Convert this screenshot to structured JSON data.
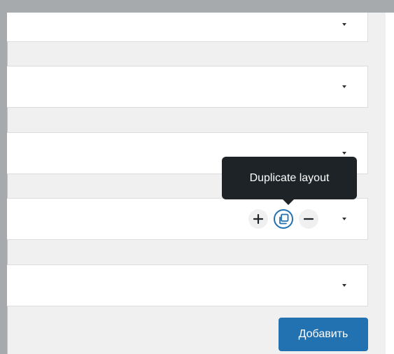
{
  "layout_rows": [
    {
      "id": 1,
      "has_select": true
    },
    {
      "id": 2,
      "has_select": true
    },
    {
      "id": 3,
      "has_select": true
    },
    {
      "id": 4,
      "has_select": true,
      "hovered": true
    },
    {
      "id": 5,
      "has_select": true
    }
  ],
  "row_actions": {
    "add_icon": "plus-icon",
    "duplicate_icon": "duplicate-icon",
    "remove_icon": "minus-icon"
  },
  "tooltip": {
    "text": "Duplicate layout"
  },
  "footer": {
    "add_button_label": "Добавить"
  },
  "colors": {
    "accent": "#2271b1",
    "tooltip_bg": "#1d2327",
    "row_border": "#dcdcde",
    "frame": "#a7aaad"
  }
}
